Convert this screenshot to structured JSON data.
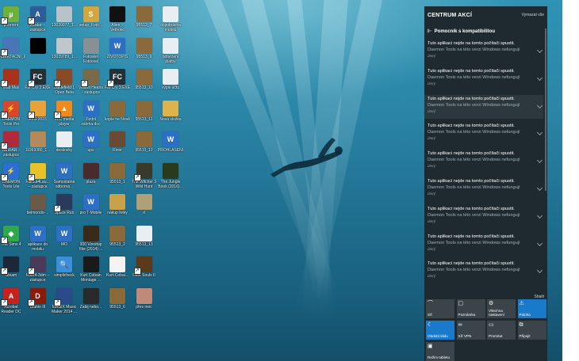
{
  "desktop_icons": [
    {
      "label": "µTorrent",
      "color": "#6bb13a",
      "glyph": "µ",
      "shortcut": true
    },
    {
      "label": "Avatar – zástupce",
      "color": "#2d5c96",
      "glyph": "A",
      "shortcut": true
    },
    {
      "label": "13039077_1...",
      "color": "#b8c2c8",
      "glyph": "",
      "shortcut": false
    },
    {
      "label": "setup_Foto...",
      "color": "#d4a640",
      "glyph": "S",
      "shortcut": false
    },
    {
      "label": "Alien – Vetřelec",
      "color": "#111111",
      "glyph": "",
      "shortcut": false
    },
    {
      "label": "95513_7",
      "color": "#8a6a3a",
      "glyph": "",
      "shortcut": false
    },
    {
      "label": "objednávka mobilu",
      "color": "#e8eef2",
      "glyph": "",
      "shortcut": false
    },
    {
      "label": "DISERTAČNÍ_EXA",
      "color": "#4a76b8",
      "glyph": "",
      "shortcut": true
    },
    {
      "label": "",
      "color": "#000000",
      "glyph": "",
      "shortcut": false
    },
    {
      "label": "13039789_1...",
      "color": "#c0c6ca",
      "glyph": "",
      "shortcut": false
    },
    {
      "label": "Fotoskel Fotoovel",
      "color": "#8a8f93",
      "glyph": "",
      "shortcut": false
    },
    {
      "label": "ŽIVOTOPIS",
      "color": "#2c6fc5",
      "glyph": "W",
      "shortcut": false
    },
    {
      "label": "95513_9",
      "color": "#8a6a3a",
      "glyph": "",
      "shortcut": false
    },
    {
      "label": "potvrzení platby",
      "color": "#e8eef2",
      "glyph": "",
      "shortcut": false
    },
    {
      "label": "Mad Max",
      "color": "#a8321c",
      "glyph": "",
      "shortcut": true
    },
    {
      "label": "Far Cry 3 EXE",
      "color": "#233036",
      "glyph": "FC",
      "shortcut": true
    },
    {
      "label": "Battlefield 1 Open Beta",
      "color": "#8a4a25",
      "glyph": "",
      "shortcut": true
    },
    {
      "label": "Valiant Hearts - zástupce",
      "color": "#7a6a4a",
      "glyph": "",
      "shortcut": true
    },
    {
      "label": "Far Cry 3 EXE",
      "color": "#233036",
      "glyph": "FC",
      "shortcut": true
    },
    {
      "label": "95513_10",
      "color": "#8a6a3a",
      "glyph": "",
      "shortcut": false
    },
    {
      "label": "výpis účtu",
      "color": "#e8eef2",
      "glyph": "",
      "shortcut": false
    },
    {
      "label": "DAEMON Tools Pro",
      "color": "#d9472b",
      "glyph": "⚡",
      "shortcut": true
    },
    {
      "label": "AVG 2015",
      "color": "#e8a23a",
      "glyph": "",
      "shortcut": true
    },
    {
      "label": "VLC media player",
      "color": "#f08a1c",
      "glyph": "▲",
      "shortcut": true
    },
    {
      "label": "Jízdní záloha.doc",
      "color": "#2c6fc5",
      "glyph": "W",
      "shortcut": false
    },
    {
      "label": "kopie ne Nově",
      "color": "#8a6a3a",
      "glyph": "",
      "shortcut": false
    },
    {
      "label": "95513_11",
      "color": "#8a6a3a",
      "glyph": "",
      "shortcut": false
    },
    {
      "label": "Nová složka",
      "color": "#e0b34a",
      "glyph": "",
      "shortcut": false
    },
    {
      "label": "WinRAR – zástupce",
      "color": "#b02a3a",
      "glyph": "",
      "shortcut": true
    },
    {
      "label": "11969380_1...",
      "color": "#b58a5a",
      "glyph": "",
      "shortcut": false
    },
    {
      "label": "deskovky",
      "color": "#e8eef2",
      "glyph": "",
      "shortcut": false
    },
    {
      "label": "upv",
      "color": "#2c6fc5",
      "glyph": "W",
      "shortcut": false
    },
    {
      "label": "River",
      "color": "#6a4a32",
      "glyph": "",
      "shortcut": false
    },
    {
      "label": "95513_12",
      "color": "#8a6a3a",
      "glyph": "",
      "shortcut": false
    },
    {
      "label": "PROHLÁŠENÍ",
      "color": "#2c6fc5",
      "glyph": "W",
      "shortcut": false
    },
    {
      "label": "DAEMON Tools Lite",
      "color": "#2a6fd1",
      "glyph": "⚡",
      "shortcut": true
    },
    {
      "label": "Fallout4Lau... – zástupce",
      "color": "#e8c22a",
      "glyph": "",
      "shortcut": true
    },
    {
      "label": "Samostatná odborná...",
      "color": "#2c6fc5",
      "glyph": "W",
      "shortcut": false
    },
    {
      "label": "plaza",
      "color": "#4a2a2a",
      "glyph": "",
      "shortcut": false
    },
    {
      "label": "95513_1",
      "color": "#8a6a3a",
      "glyph": "",
      "shortcut": false
    },
    {
      "label": "The Witcher 3 Wild Hunt",
      "color": "#3a3a2a",
      "glyph": "",
      "shortcut": true
    },
    {
      "label": "The Jungle Book (2016)...",
      "color": "#2a3a1a",
      "glyph": "",
      "shortcut": false
    },
    {
      "label": "",
      "color": "#00000000",
      "glyph": "",
      "shortcut": false
    },
    {
      "label": "belmondo-...",
      "color": "#6a5a4a",
      "glyph": "",
      "shortcut": false
    },
    {
      "label": "Space Run",
      "color": "#2a3a5a",
      "glyph": "",
      "shortcut": true
    },
    {
      "label": "pro T-Mobile",
      "color": "#2c6fc5",
      "glyph": "W",
      "shortcut": false
    },
    {
      "label": "nákup fotky",
      "color": "#c9a14a",
      "glyph": "",
      "shortcut": false
    },
    {
      "label": "d",
      "color": "#b0a07a",
      "glyph": "",
      "shortcut": false
    },
    {
      "label": "",
      "color": "#00000000",
      "glyph": "",
      "shortcut": false
    },
    {
      "label": "The Sims 4",
      "color": "#2fa84a",
      "glyph": "◆",
      "shortcut": true
    },
    {
      "label": "aplikace do mobilu",
      "color": "#2c6fc5",
      "glyph": "W",
      "shortcut": false
    },
    {
      "label": "MO",
      "color": "#2c6fc5",
      "glyph": "W",
      "shortcut": false
    },
    {
      "label": "300 Vzestup říše (2014) ...",
      "color": "#3a2a1a",
      "glyph": "",
      "shortcut": false
    },
    {
      "label": "95513_2",
      "color": "#8a6a3a",
      "glyph": "",
      "shortcut": false
    },
    {
      "label": "95513_13",
      "color": "#e8eef2",
      "glyph": "",
      "shortcut": false
    },
    {
      "label": "",
      "color": "#00000000",
      "glyph": "",
      "shortcut": false
    },
    {
      "label": "Steam",
      "color": "#1b2838",
      "glyph": "",
      "shortcut": true
    },
    {
      "label": "Rfa14-3dm – zástupce",
      "color": "#4a3a5a",
      "glyph": "",
      "shortcut": true
    },
    {
      "label": "simplicheck",
      "color": "#3b8fd9",
      "glyph": "🔍",
      "shortcut": false
    },
    {
      "label": "Kurt Cobain Montage ...",
      "color": "#1a1a1a",
      "glyph": "",
      "shortcut": false
    },
    {
      "label": "Kurt-Cobai...",
      "color": "#f4f4f4",
      "glyph": "",
      "shortcut": false
    },
    {
      "label": "Dark Souls II",
      "color": "#5a3a1a",
      "glyph": "",
      "shortcut": true
    },
    {
      "label": "",
      "color": "#00000000",
      "glyph": "",
      "shortcut": false
    },
    {
      "label": "Acrobat Reader DC",
      "color": "#c8201a",
      "glyph": "A",
      "shortcut": true
    },
    {
      "label": "Diablo III",
      "color": "#8a1a0a",
      "glyph": "D",
      "shortcut": true
    },
    {
      "label": "MAGIX Music Maker 2014 ...",
      "color": "#2a4a8a",
      "glyph": "",
      "shortcut": true
    },
    {
      "label": "Zabij nebo...",
      "color": "#2a2a2a",
      "glyph": "",
      "shortcut": false
    },
    {
      "label": "95513_6",
      "color": "#8a6a3a",
      "glyph": "",
      "shortcut": false
    },
    {
      "label": "přes moc",
      "color": "#c08a7a",
      "glyph": "",
      "shortcut": false
    },
    {
      "label": "",
      "color": "#00000000",
      "glyph": "",
      "shortcut": false
    }
  ],
  "action_center": {
    "title": "CENTRUM AKCÍ",
    "clear_all": "Vymazat vše",
    "group_title": "Pomocník s kompatibilitou",
    "group_icon": "compatibility-assistant-icon",
    "notifications": [
      {
        "line1": "Tuto aplikaci nejde na tomto počítači spustit.",
        "line2": "Daemon Tools na této verzi Windows nefungují",
        "time": "úterý",
        "highlighted": false
      },
      {
        "line1": "Tuto aplikaci nejde na tomto počítači spustit.",
        "line2": "Daemon Tools na této verzi Windows nefungují",
        "time": "úterý",
        "highlighted": false
      },
      {
        "line1": "Tuto aplikaci nejde na tomto počítači spustit.",
        "line2": "Daemon Tools na této verzi Windows nefungují",
        "time": "úterý",
        "highlighted": true
      },
      {
        "line1": "Tuto aplikaci nejde na tomto počítači spustit.",
        "line2": "Daemon Tools na této verzi Windows nefungují",
        "time": "úterý",
        "highlighted": false
      },
      {
        "line1": "Tuto aplikaci nejde na tomto počítači spustit.",
        "line2": "Daemon Tools na této verzi Windows nefungují",
        "time": "úterý",
        "highlighted": false
      },
      {
        "line1": "Tuto aplikaci nejde na tomto počítači spustit.",
        "line2": "Daemon Tools na této verzi Windows nefungují",
        "time": "úterý",
        "highlighted": false
      },
      {
        "line1": "Tuto aplikaci nejde na tomto počítači spustit.",
        "line2": "Daemon Tools na této verzi Windows nefungují",
        "time": "úterý",
        "highlighted": false
      },
      {
        "line1": "Tuto aplikaci nejde na tomto počítači spustit.",
        "line2": "Daemon Tools na této verzi Windows nefungují",
        "time": "úterý",
        "highlighted": false
      },
      {
        "line1": "Tuto aplikaci nejde na tomto počítači spustit.",
        "line2": "Daemon Tools na této verzi Windows nefungují",
        "time": "úterý",
        "highlighted": false
      }
    ],
    "collapse": "Sbalit",
    "quick_actions": [
      {
        "label": "Síť",
        "icon": "network-icon",
        "glyph": "⌒",
        "on": false
      },
      {
        "label": "Poznámka",
        "icon": "note-icon",
        "glyph": "▢",
        "on": false
      },
      {
        "label": "Všechna nastavení",
        "icon": "settings-icon",
        "glyph": "⚙",
        "on": false
      },
      {
        "label": "Poloha",
        "icon": "location-icon",
        "glyph": "⚠",
        "on": true
      },
      {
        "label": "Období klidu",
        "icon": "quiet-hours-icon",
        "glyph": "☾",
        "on": true
      },
      {
        "label": "Síť VPN",
        "icon": "vpn-icon",
        "glyph": "∞",
        "on": false
      },
      {
        "label": "Promítat",
        "icon": "project-icon",
        "glyph": "▭",
        "on": false
      },
      {
        "label": "Připojit",
        "icon": "connect-icon",
        "glyph": "⧉",
        "on": false
      },
      {
        "label": "Režim tabletu",
        "icon": "tablet-mode-icon",
        "glyph": "▣",
        "on": false
      }
    ]
  }
}
